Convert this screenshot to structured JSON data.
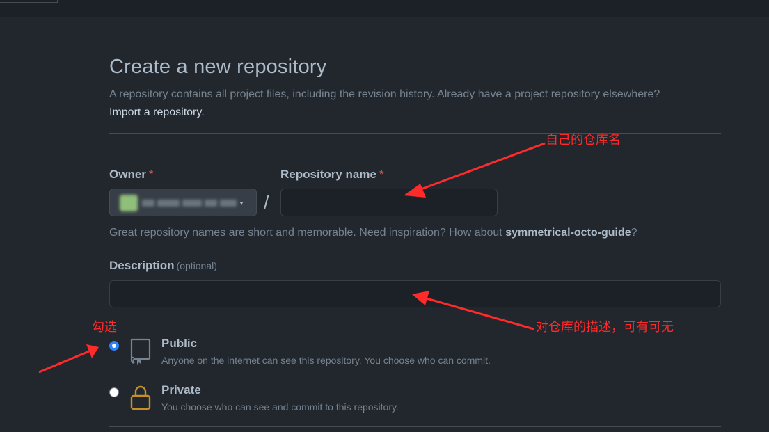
{
  "header": {
    "title": "Create a new repository",
    "subtitle": "A repository contains all project files, including the revision history. Already have a project repository elsewhere?",
    "import_link": "Import a repository."
  },
  "form": {
    "owner_label": "Owner",
    "repo_name_label": "Repository name",
    "required_mark": "*",
    "separator": "/",
    "repo_name_value": "",
    "hint_prefix": "Great repository names are short and memorable. Need inspiration? How about ",
    "hint_suggestion": "symmetrical-octo-guide",
    "hint_suffix": "?",
    "description_label": "Description",
    "description_optional": "(optional)",
    "description_value": ""
  },
  "visibility": {
    "options": [
      {
        "title": "Public",
        "desc": "Anyone on the internet can see this repository. You choose who can commit.",
        "selected": true,
        "icon": "repo-book-icon"
      },
      {
        "title": "Private",
        "desc": "You choose who can see and commit to this repository.",
        "selected": false,
        "icon": "lock-icon"
      }
    ]
  },
  "annotations": {
    "repo_name_note": "自己的仓库名",
    "description_note": "对仓库的描述，可有可无",
    "check_note": "勾选",
    "color": "#ff2a2a"
  }
}
